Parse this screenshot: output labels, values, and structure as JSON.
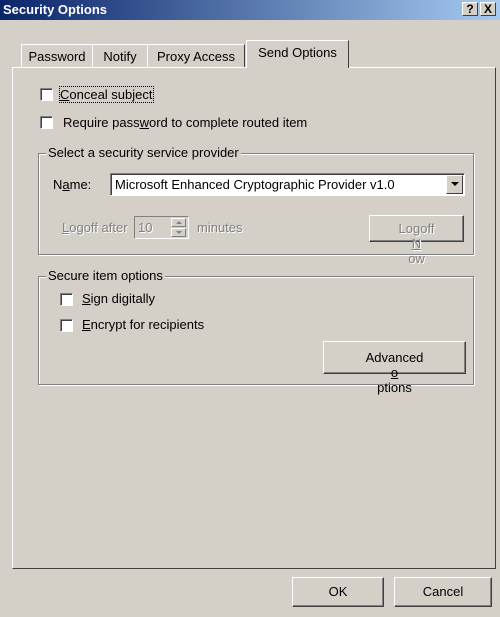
{
  "window": {
    "title": "Security Options",
    "help_glyph": "?",
    "close_glyph": "X"
  },
  "tabs": [
    {
      "label": "Password",
      "active": false
    },
    {
      "label": "Notify",
      "active": false
    },
    {
      "label": "Proxy Access",
      "active": false
    },
    {
      "label": "Send Options",
      "active": true
    }
  ],
  "send_options": {
    "conceal_subject": {
      "pre": "",
      "key": "C",
      "post": "onceal subject",
      "checked": false
    },
    "require_password": {
      "pre": "Require pass",
      "key": "w",
      "post": "ord to complete routed item",
      "checked": false
    }
  },
  "provider_group": {
    "title": "Select a security service provider",
    "name_label": {
      "pre": "N",
      "key": "a",
      "post": "me:"
    },
    "provider_value": "Microsoft Enhanced Cryptographic Provider v1.0",
    "logoff_after": {
      "pre": "",
      "key": "L",
      "post": "ogoff after"
    },
    "logoff_minutes": "10",
    "minutes_label": "minutes",
    "logoff_now_button": {
      "pre": "Logoff ",
      "key": "N",
      "post": "ow"
    }
  },
  "secure_group": {
    "title": "Secure item options",
    "sign_digitally": {
      "pre": "",
      "key": "S",
      "post": "ign digitally",
      "checked": false
    },
    "encrypt": {
      "pre": "",
      "key": "E",
      "post": "ncrypt for recipients",
      "checked": false
    },
    "advanced_button": {
      "pre": "Advanced ",
      "key": "o",
      "post": "ptions"
    }
  },
  "footer": {
    "ok_label": "OK",
    "cancel_label": "Cancel"
  },
  "colors": {
    "titlebar_start": "#0a246a",
    "titlebar_end": "#a6caf0",
    "dialog_face": "#d4d0c8"
  }
}
